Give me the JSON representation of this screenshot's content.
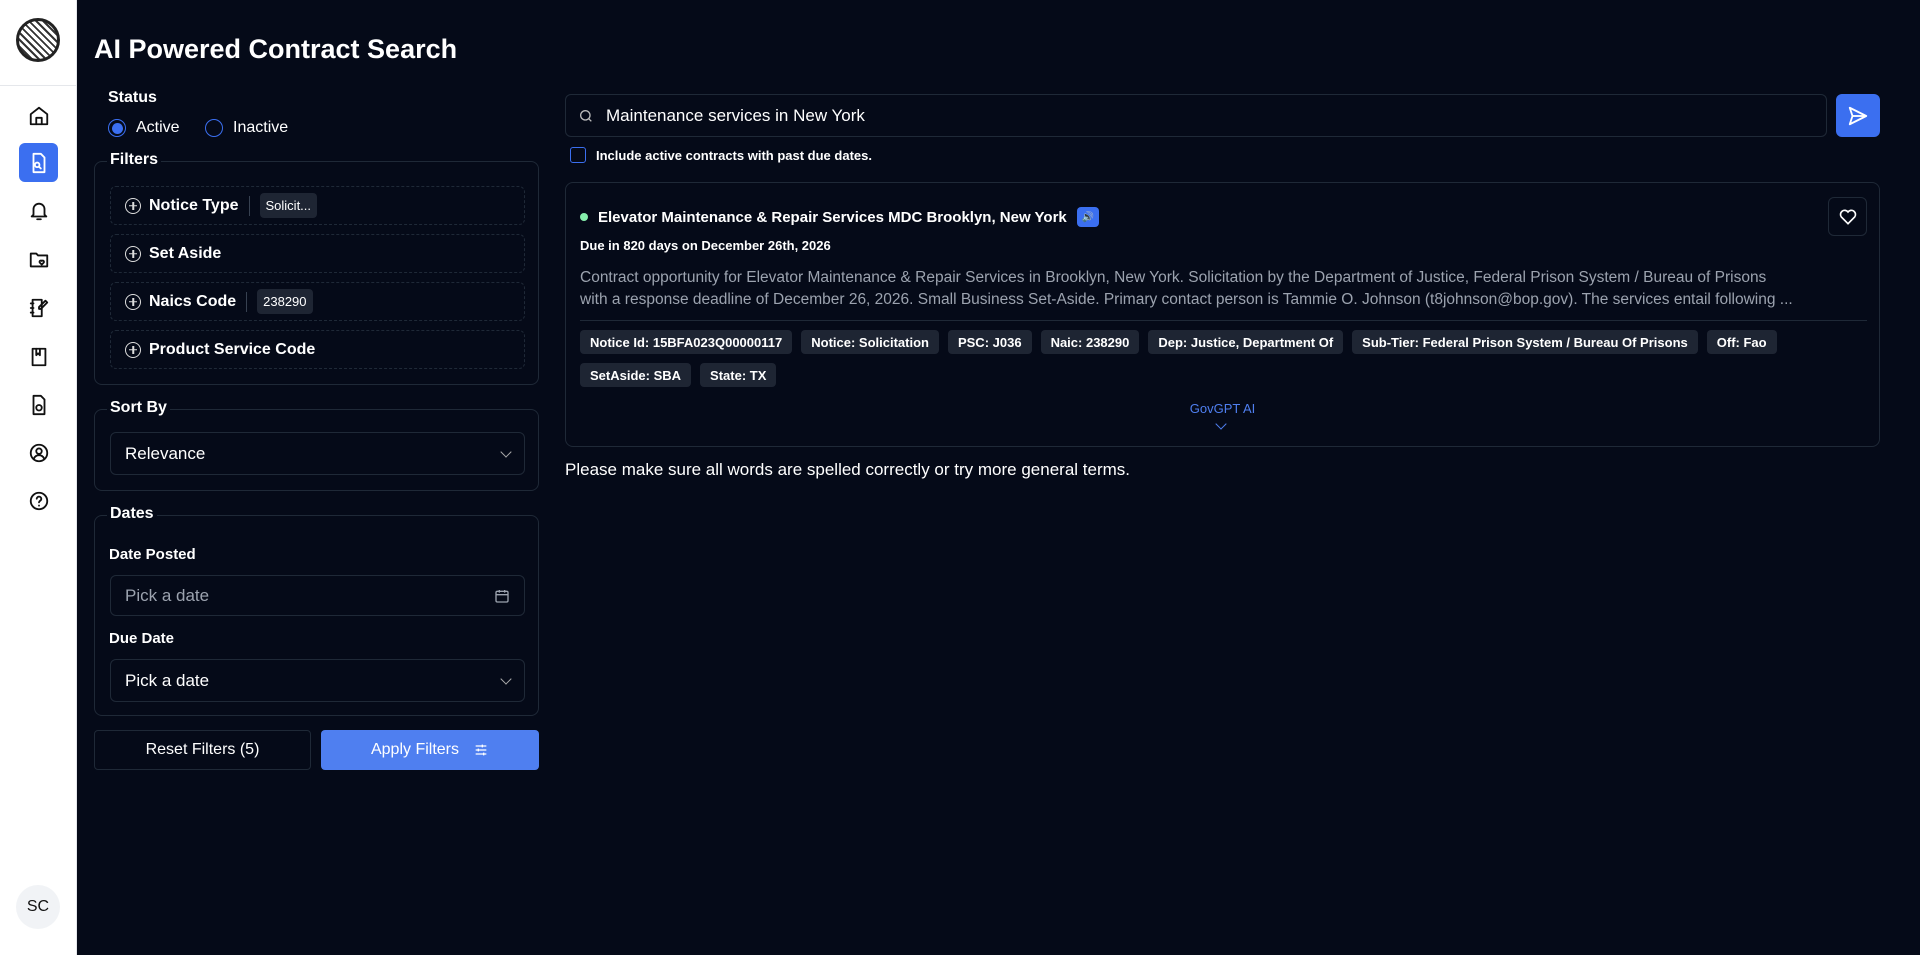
{
  "page": {
    "title": "AI Powered Contract Search"
  },
  "sidebar": {
    "items": [
      "home",
      "contract-search",
      "notifications",
      "saved-folders",
      "notes",
      "library",
      "documents",
      "profile",
      "help"
    ],
    "active": "contract-search",
    "avatar": "SC"
  },
  "status": {
    "label": "Status",
    "options": [
      "Active",
      "Inactive"
    ],
    "selected": "Active"
  },
  "filters": {
    "label": "Filters",
    "items": [
      {
        "label": "Notice Type",
        "value": "Solicit..."
      },
      {
        "label": "Set Aside",
        "value": null
      },
      {
        "label": "Naics Code",
        "value": "238290"
      },
      {
        "label": "Product Service Code",
        "value": null
      }
    ]
  },
  "sort": {
    "label": "Sort By",
    "value": "Relevance"
  },
  "dates": {
    "label": "Dates",
    "posted_label": "Date Posted",
    "posted_placeholder": "Pick a date",
    "due_label": "Due Date",
    "due_value": "Pick a date"
  },
  "buttons": {
    "reset": "Reset Filters (5)",
    "apply": "Apply Filters"
  },
  "search": {
    "value": "Maintenance services in New York",
    "include_past_due": "Include active contracts with past due dates.",
    "include_checked": false
  },
  "result": {
    "title": "Elevator Maintenance & Repair Services MDC Brooklyn, New York",
    "due": "Due in 820 days on December 26th, 2026",
    "desc1": "Contract opportunity for Elevator Maintenance & Repair Services in Brooklyn, New York. Solicitation by the Department of Justice, Federal Prison System / Bureau of Prisons",
    "desc2": "with a response deadline of December 26, 2026. Small Business Set-Aside. Primary contact person is Tammie O. Johnson (t8johnson@bop.gov). The services entail following ...",
    "tags": [
      "Notice Id: 15BFA023Q00000117",
      "Notice: Solicitation",
      "PSC: J036",
      "Naic: 238290",
      "Dep: Justice, Department Of",
      "Sub-Tier: Federal Prison System / Bureau Of Prisons",
      "Off: Fao",
      "SetAside: SBA",
      "State: TX"
    ],
    "ai_label": "GovGPT AI"
  },
  "message": "Please make sure all words are spelled correctly or try more general terms.",
  "colors": {
    "accent": "#3b6ff0",
    "background": "#050a18",
    "active_dot": "#86efac"
  }
}
